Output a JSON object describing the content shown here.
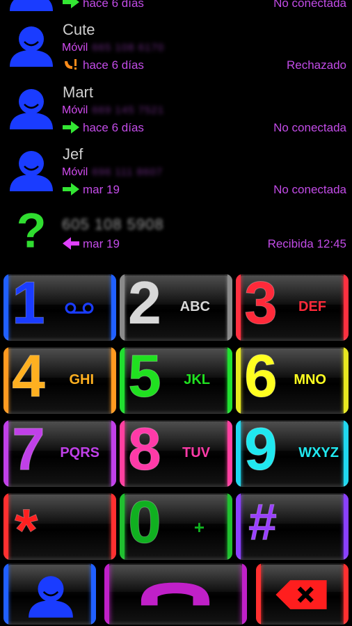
{
  "call_log": [
    {
      "name": "",
      "type": "",
      "number": "",
      "direction": "outgoing",
      "date": "hace 6 días",
      "status": "No conectada"
    },
    {
      "name": "Cute",
      "type": "Móvil",
      "number": "665 108 6170",
      "direction": "missed",
      "date": "hace 6 días",
      "status": "Rechazado"
    },
    {
      "name": "Mart",
      "type": "Móvil",
      "number": "669 145 7521",
      "direction": "outgoing",
      "date": "hace 6 días",
      "status": "No conectada"
    },
    {
      "name": "Jef",
      "type": "Móvil",
      "number": "696 111 8607",
      "direction": "outgoing",
      "date": "mar 19",
      "status": "No conectada"
    },
    {
      "name": "605 108 5908",
      "type": "",
      "number": "",
      "direction": "incoming",
      "date": "mar 19",
      "status": "Recibida 12:45"
    }
  ],
  "keypad": [
    {
      "digit": "1",
      "letters": "oo",
      "color": "#1a3cff",
      "edge": "#2060ff"
    },
    {
      "digit": "2",
      "letters": "ABC",
      "color": "#d8d8d8",
      "edge": "#9a9a9a"
    },
    {
      "digit": "3",
      "letters": "DEF",
      "color": "#ff2a3a",
      "edge": "#ff3040"
    },
    {
      "digit": "4",
      "letters": "GHI",
      "color": "#ffb020",
      "edge": "#ff9a20"
    },
    {
      "digit": "5",
      "letters": "JKL",
      "color": "#20e020",
      "edge": "#20e030"
    },
    {
      "digit": "6",
      "letters": "MNO",
      "color": "#ffff20",
      "edge": "#e8e820"
    },
    {
      "digit": "7",
      "letters": "PQRS",
      "color": "#c040e8",
      "edge": "#c040e8"
    },
    {
      "digit": "8",
      "letters": "TUV",
      "color": "#ff3aa8",
      "edge": "#ff40a0"
    },
    {
      "digit": "9",
      "letters": "WXYZ",
      "color": "#20e8f0",
      "edge": "#20d8f0"
    },
    {
      "digit": "*",
      "letters": "",
      "color": "#ff2020",
      "edge": "#ff3030"
    },
    {
      "digit": "0",
      "letters": "+",
      "color": "#10b020",
      "edge": "#20c030"
    },
    {
      "digit": "#",
      "letters": "",
      "color": "#9a40ff",
      "edge": "#8a40ff"
    }
  ],
  "actions": {
    "contacts_icon": "person-icon",
    "call_icon": "phone-handset-icon",
    "delete_icon": "backspace-icon",
    "contacts_color": "#1a3cff",
    "call_color": "#c020c8",
    "delete_color": "#ff2020"
  }
}
